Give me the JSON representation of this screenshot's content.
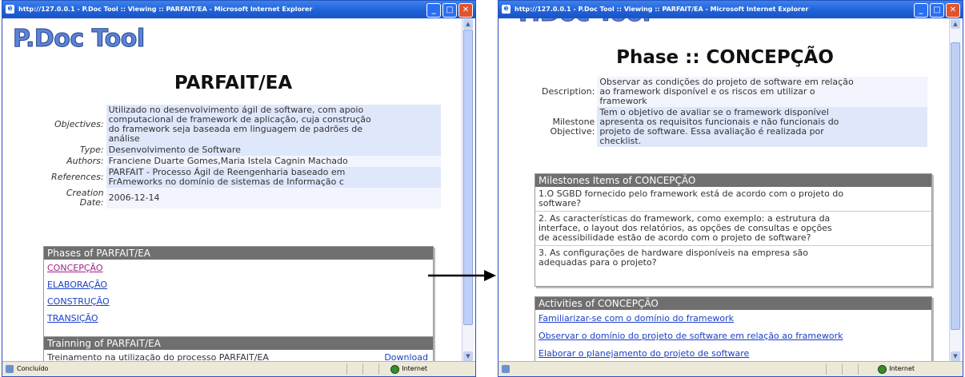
{
  "left_window": {
    "title": "http://127.0.0.1 - P.Doc Tool :: Viewing :: PARFAIT/EA - Microsoft Internet Explorer",
    "logo": "P.Doc Tool",
    "heading": "PARFAIT/EA",
    "info": {
      "objectives_label": "Objectives:",
      "objectives_lines": [
        "Utilizado no desenvolvimento ágil de software, com apoio",
        "computacional de framework de aplicação, cuja construção",
        "do framework seja baseada em linguagem de padrões de",
        "análise"
      ],
      "type_label": "Type:",
      "type_value": "Desenvolvimento de Software",
      "authors_label": "Authors:",
      "authors_value": "Franciene Duarte Gomes,Maria Istela Cagnin Machado",
      "references_label": "References:",
      "references_lines": [
        "PARFAIT - Processo Ágil de Reengenharia baseado em",
        "FrAmeworks no domínio de sistemas de Informação c"
      ],
      "creation_label_1": "Creation",
      "creation_label_2": "Date:",
      "creation_value": "2006-12-14"
    },
    "phases": {
      "header": "Phases of PARFAIT/EA",
      "items": [
        "CONCEPÇÃO",
        "ELABORAÇÃO",
        "CONSTRUÇÃO",
        "TRANSIÇÃO"
      ]
    },
    "training": {
      "header": "Trainning of PARFAIT/EA",
      "partial_text": "Treinamento na utilização do processo PARFAIT/EA",
      "download": "Download"
    },
    "status": "Concluído",
    "zone": "Internet"
  },
  "right_window": {
    "title": "http://127.0.0.1 - P.Doc Tool :: Viewing :: PARFAIT/EA - Microsoft Internet Explorer",
    "logo_partial": "P.Doc Tool",
    "heading": "Phase :: CONCEPÇÃO",
    "info": {
      "description_label": "Description:",
      "description_lines": [
        "Observar as condições do projeto de software em relação",
        "ao framework disponível e os riscos em utilizar o",
        "framework"
      ],
      "milestone_label_1": "Milestone",
      "milestone_label_2": "Objective:",
      "milestone_lines": [
        "Tem o objetivo de avaliar se o framework disponível",
        "apresenta os requisitos funcionais e não funcionais do",
        "projeto de software. Essa avaliação é realizada por",
        "checklist."
      ]
    },
    "milestones": {
      "header": "Milestones Items of CONCEPÇÃO",
      "items": [
        [
          "1.O SGBD fornecido pelo framework está de acordo com o projeto do",
          "software?"
        ],
        [
          "2. As características do framework, como exemplo: a estrutura da",
          "interface, o layout dos relatórios, as opções de consultas e opções",
          "de acessibilidade estão de acordo com o projeto de software?"
        ],
        [
          "3. As configurações de hardware disponíveis na empresa são",
          "adequadas para o projeto?"
        ]
      ]
    },
    "activities": {
      "header": "Activities of CONCEPÇÃO",
      "items": [
        "Familiarizar-se com o domínio do framework",
        "Observar o domínio do projeto de software em relação ao framework",
        "Elaborar o planejamento do projeto de software"
      ]
    },
    "zone": "Internet"
  },
  "colors": {
    "titlebar": "#1f5fd6",
    "logo": "#5c83d6",
    "box_header": "#6f6f6f",
    "link": "#1a3fc4",
    "visited_link": "#a0228a",
    "row_a": "#dfe8fb",
    "row_b": "#f2f5fd"
  }
}
